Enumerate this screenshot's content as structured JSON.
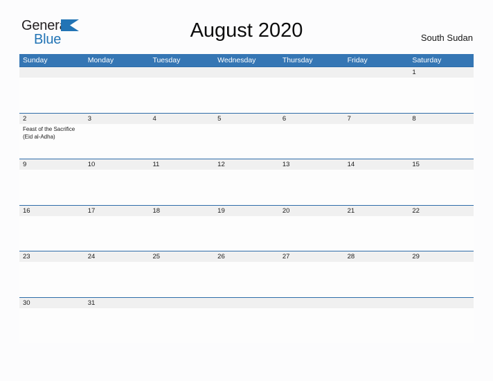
{
  "brand": {
    "word1": "General",
    "word2": "Blue",
    "flag_icon": "blue-triangle-flag-icon",
    "color_dark": "#231f20",
    "color_blue": "#2274b5"
  },
  "header": {
    "title": "August 2020",
    "country": "South Sudan"
  },
  "theme": {
    "header_blue": "#3576b4",
    "rule_blue": "#2d6ca8",
    "number_band_gray": "#f0f0f0",
    "page_background": "#fcfcfd"
  },
  "calendar": {
    "weekdays": [
      "Sunday",
      "Monday",
      "Tuesday",
      "Wednesday",
      "Thursday",
      "Friday",
      "Saturday"
    ],
    "weeks": [
      [
        {
          "day": "",
          "events": []
        },
        {
          "day": "",
          "events": []
        },
        {
          "day": "",
          "events": []
        },
        {
          "day": "",
          "events": []
        },
        {
          "day": "",
          "events": []
        },
        {
          "day": "",
          "events": []
        },
        {
          "day": "1",
          "events": []
        }
      ],
      [
        {
          "day": "2",
          "events": [
            "Feast of the Sacrifice (Eid al-Adha)"
          ]
        },
        {
          "day": "3",
          "events": []
        },
        {
          "day": "4",
          "events": []
        },
        {
          "day": "5",
          "events": []
        },
        {
          "day": "6",
          "events": []
        },
        {
          "day": "7",
          "events": []
        },
        {
          "day": "8",
          "events": []
        }
      ],
      [
        {
          "day": "9",
          "events": []
        },
        {
          "day": "10",
          "events": []
        },
        {
          "day": "11",
          "events": []
        },
        {
          "day": "12",
          "events": []
        },
        {
          "day": "13",
          "events": []
        },
        {
          "day": "14",
          "events": []
        },
        {
          "day": "15",
          "events": []
        }
      ],
      [
        {
          "day": "16",
          "events": []
        },
        {
          "day": "17",
          "events": []
        },
        {
          "day": "18",
          "events": []
        },
        {
          "day": "19",
          "events": []
        },
        {
          "day": "20",
          "events": []
        },
        {
          "day": "21",
          "events": []
        },
        {
          "day": "22",
          "events": []
        }
      ],
      [
        {
          "day": "23",
          "events": []
        },
        {
          "day": "24",
          "events": []
        },
        {
          "day": "25",
          "events": []
        },
        {
          "day": "26",
          "events": []
        },
        {
          "day": "27",
          "events": []
        },
        {
          "day": "28",
          "events": []
        },
        {
          "day": "29",
          "events": []
        }
      ],
      [
        {
          "day": "30",
          "events": []
        },
        {
          "day": "31",
          "events": []
        },
        {
          "day": "",
          "events": []
        },
        {
          "day": "",
          "events": []
        },
        {
          "day": "",
          "events": []
        },
        {
          "day": "",
          "events": []
        },
        {
          "day": "",
          "events": []
        }
      ]
    ]
  }
}
